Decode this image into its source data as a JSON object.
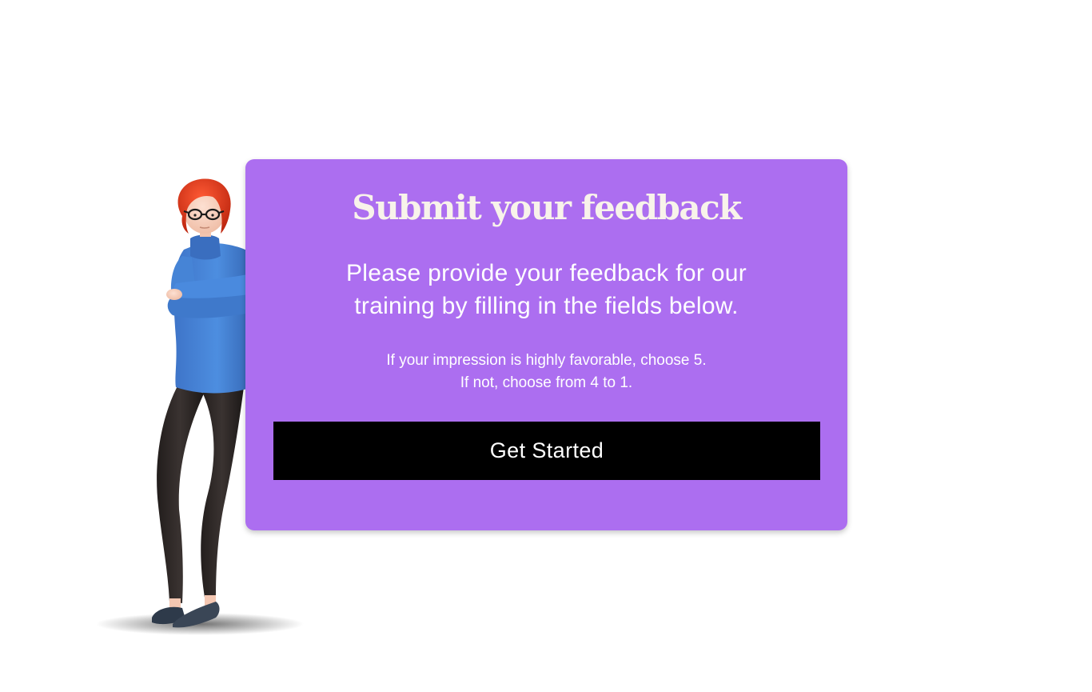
{
  "card": {
    "title": "Submit your feedback",
    "subtitle": "Please provide your feedback for our training by filling in the fields below.",
    "instructions": [
      "If your impression is highly favorable, choose 5.",
      "If not, choose from 4 to 1."
    ],
    "button_label": "Get Started"
  },
  "colors": {
    "page_background": "#ffffff",
    "card_background": "#ac6ef0",
    "title_text": "#f8f3ea",
    "body_text": "#ffffff",
    "button_background": "#000000",
    "button_text": "#ffffff"
  },
  "illustration": {
    "icon": "woman-arms-crossed-3d-character"
  }
}
